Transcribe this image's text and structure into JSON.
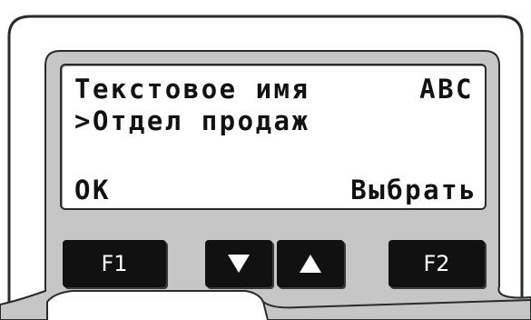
{
  "display": {
    "line1_left": "Текстовое имя",
    "line1_right": "ABC",
    "line2": ">Отдел продаж",
    "line4_left": "OK",
    "line4_right": "Выбрать"
  },
  "keys": {
    "f1_label": "F1",
    "f2_label": "F2",
    "down_icon": "triangle-down",
    "up_icon": "triangle-up"
  },
  "colors": {
    "panel": "#c6c6c6",
    "outline": "#2a2a2a",
    "key": "#111111",
    "screen": "#ffffff"
  }
}
